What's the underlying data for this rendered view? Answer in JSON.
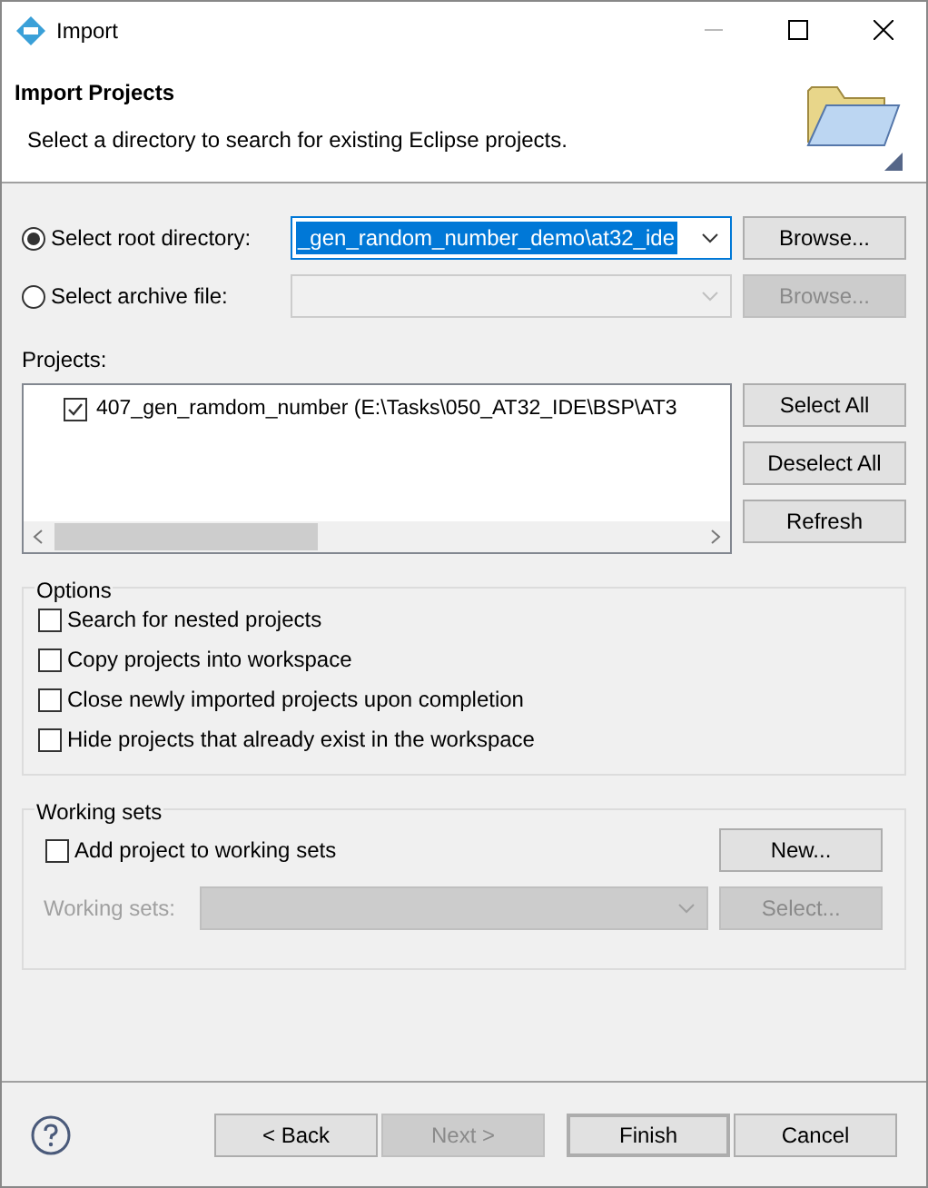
{
  "window": {
    "title": "Import"
  },
  "header": {
    "title": "Import Projects",
    "description": "Select a directory to search for existing Eclipse projects."
  },
  "source": [
    {
      "label": "Select root directory:",
      "selected": true,
      "value": "_gen_random_number_demo\\at32_ide",
      "browse": "Browse...",
      "disabled": false
    },
    {
      "label": "Select archive file:",
      "selected": false,
      "browse": "Browse...",
      "disabled": true
    }
  ],
  "projects": {
    "label": "Projects:",
    "items": [
      {
        "label": "407_gen_ramdom_number (E:\\Tasks\\050_AT32_IDE\\BSP\\AT3",
        "checked": true
      }
    ],
    "buttons": [
      "Select All",
      "Deselect All",
      "Refresh"
    ]
  },
  "options": {
    "title": "Options",
    "items": [
      {
        "label": "Search for nested projects",
        "checked": false
      },
      {
        "label": "Copy projects into workspace",
        "checked": false
      },
      {
        "label": "Close newly imported projects upon completion",
        "checked": false
      },
      {
        "label": "Hide projects that already exist in the workspace",
        "checked": false
      }
    ]
  },
  "working_sets": {
    "title": "Working sets",
    "add": {
      "label": "Add project to working sets",
      "checked": false
    },
    "new_button": "New...",
    "field_label": "Working sets:",
    "select_button": "Select...",
    "disabled": true
  },
  "footer": [
    {
      "label": "< Back",
      "disabled": false,
      "default": false
    },
    {
      "label": "Next >",
      "disabled": true,
      "default": false
    },
    {
      "label": "Finish",
      "disabled": false,
      "default": true
    },
    {
      "label": "Cancel",
      "disabled": false,
      "default": false
    }
  ]
}
